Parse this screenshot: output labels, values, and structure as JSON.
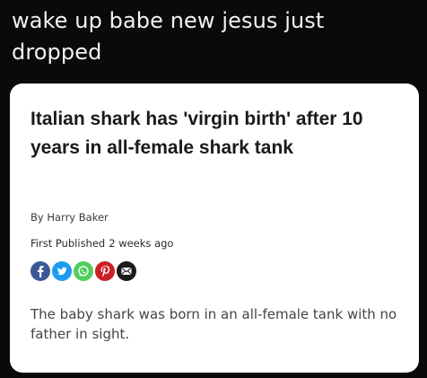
{
  "caption": {
    "line1": "wake up babe new jesus just",
    "line2": "dropped"
  },
  "article": {
    "headline": "Italian shark has 'virgin birth' after 10 years in all-female shark tank",
    "byline": "By Harry Baker",
    "published_label": "First Published",
    "published_when": "2 weeks ago",
    "body": "The baby shark was born in an all-female tank with no father in sight."
  },
  "share_icons": [
    "facebook-icon",
    "twitter-icon",
    "whatsapp-icon",
    "pinterest-icon",
    "email-icon"
  ],
  "colors": {
    "background": "#0a0a0a",
    "card": "#ffffff",
    "facebook": "#3b5998",
    "twitter": "#1d9bf0",
    "whatsapp": "#4fce5d",
    "pinterest": "#cb2027",
    "email": "#1a1a1a"
  }
}
